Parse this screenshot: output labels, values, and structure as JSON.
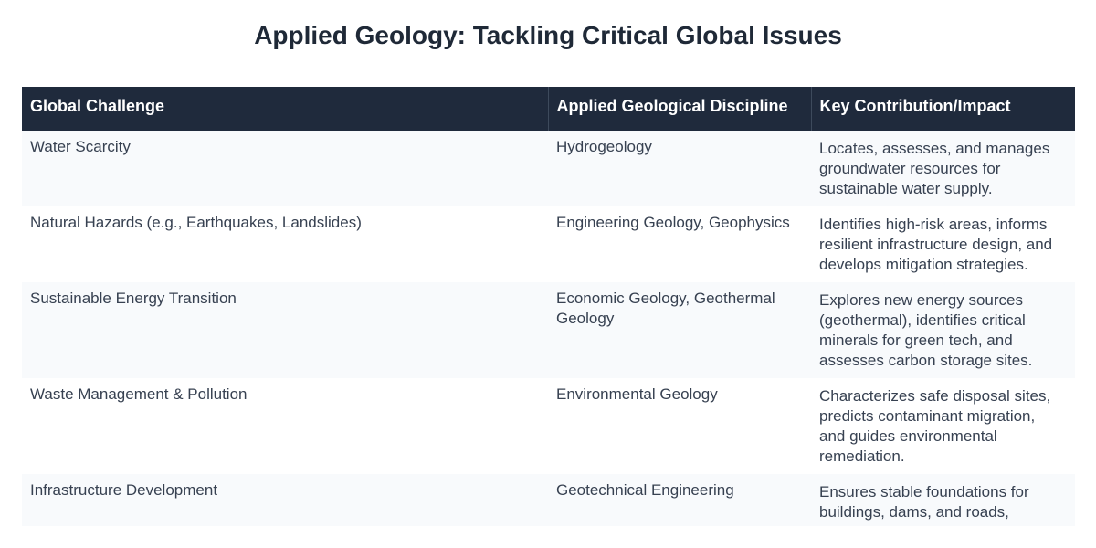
{
  "title": "Applied Geology: Tackling Critical Global Issues",
  "table": {
    "headers": [
      "Global Challenge",
      "Applied Geological Discipline",
      "Key Contribution/Impact"
    ],
    "rows": [
      {
        "challenge": "Water Scarcity",
        "discipline": "Hydrogeology",
        "impact": "Locates, assesses, and manages groundwater resources for sustainable water supply."
      },
      {
        "challenge": "Natural Hazards (e.g., Earthquakes, Landslides)",
        "discipline": "Engineering Geology, Geophysics",
        "impact": "Identifies high-risk areas, informs resilient infrastructure design, and develops mitigation strategies."
      },
      {
        "challenge": "Sustainable Energy Transition",
        "discipline": "Economic Geology, Geothermal Geology",
        "impact": "Explores new energy sources (geothermal), identifies critical minerals for green tech, and assesses carbon storage sites."
      },
      {
        "challenge": "Waste Management & Pollution",
        "discipline": "Environmental Geology",
        "impact": "Characterizes safe disposal sites, predicts contaminant migration, and guides environmental remediation."
      },
      {
        "challenge": "Infrastructure Development",
        "discipline": "Geotechnical Engineering",
        "impact": "Ensures stable foundations for buildings, dams, and roads, optimizing construction safety and"
      }
    ]
  },
  "colors": {
    "header_bg": "#1f2a3c",
    "header_text": "#ffffff",
    "row_alt_bg": "#f8fafc",
    "title_text": "#1f2937",
    "body_text": "#374151"
  }
}
